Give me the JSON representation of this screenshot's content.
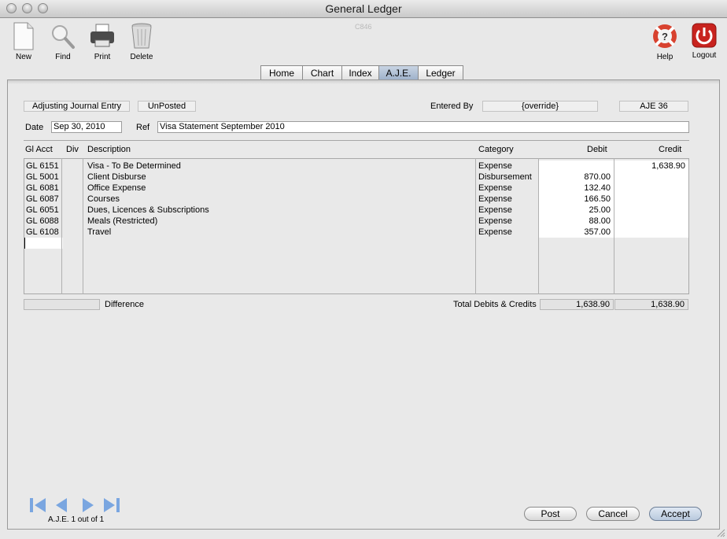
{
  "window": {
    "title": "General Ledger"
  },
  "toolbar": {
    "new": "New",
    "find": "Find",
    "print": "Print",
    "delete": "Delete",
    "help": "Help",
    "logout": "Logout",
    "code": "C846"
  },
  "tabs": [
    "Home",
    "Chart",
    "Index",
    "A.J.E.",
    "Ledger"
  ],
  "active_tab": "A.J.E.",
  "header": {
    "entry_type": "Adjusting Journal Entry",
    "status": "UnPosted",
    "entered_by_label": "Entered By",
    "entered_by_value": "{override}",
    "entry_id": "AJE 36",
    "date_label": "Date",
    "date_value": "Sep 30, 2010",
    "ref_label": "Ref",
    "ref_value": "Visa Statement September 2010"
  },
  "columns": {
    "gl_acct": "Gl Acct",
    "div": "Div",
    "description": "Description",
    "category": "Category",
    "debit": "Debit",
    "credit": "Credit"
  },
  "rows": [
    {
      "acct": "GL 6151",
      "div": "",
      "desc": "Visa - To Be Determined",
      "category": "Expense",
      "debit": "",
      "credit": "1,638.90"
    },
    {
      "acct": "GL 5001",
      "div": "",
      "desc": "Client Disburse",
      "category": "Disbursement",
      "debit": "870.00",
      "credit": ""
    },
    {
      "acct": "GL 6081",
      "div": "",
      "desc": "Office Expense",
      "category": "Expense",
      "debit": "132.40",
      "credit": ""
    },
    {
      "acct": "GL 6087",
      "div": "",
      "desc": "Courses",
      "category": "Expense",
      "debit": "166.50",
      "credit": ""
    },
    {
      "acct": "GL 6051",
      "div": "",
      "desc": "Dues, Licences & Subscriptions",
      "category": "Expense",
      "debit": "25.00",
      "credit": ""
    },
    {
      "acct": "GL 6088",
      "div": "",
      "desc": "Meals (Restricted)",
      "category": "Expense",
      "debit": "88.00",
      "credit": ""
    },
    {
      "acct": "GL 6108",
      "div": "",
      "desc": "Travel",
      "category": "Expense",
      "debit": "357.00",
      "credit": ""
    }
  ],
  "footer": {
    "difference_label": "Difference",
    "difference_value": "",
    "totals_label": "Total Debits & Credits",
    "total_debits": "1,638.90",
    "total_credits": "1,638.90",
    "record_status": "A.J.E. 1 out of 1"
  },
  "buttons": {
    "post": "Post",
    "cancel": "Cancel",
    "accept": "Accept"
  },
  "colors": {
    "logout_red": "#c8231e",
    "help_ring": "#d8422f",
    "active_tab": "#a9bbd2"
  }
}
